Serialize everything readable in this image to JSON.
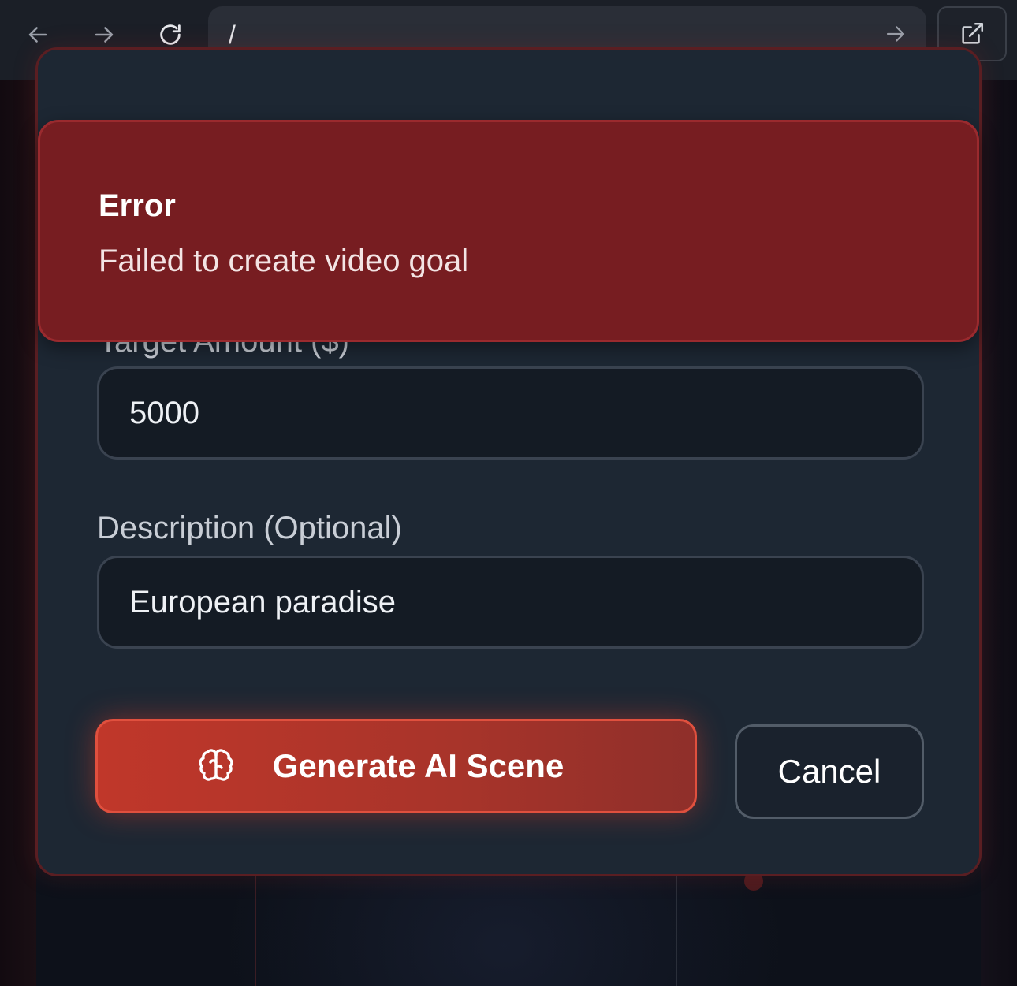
{
  "browser": {
    "url": "/",
    "back_icon": "arrow-left-icon",
    "forward_icon": "arrow-right-icon",
    "reload_icon": "reload-icon",
    "go_icon": "arrow-right-icon",
    "open_external_icon": "external-link-icon"
  },
  "form": {
    "target_amount_label": "Target Amount ($)",
    "target_amount_value": "5000",
    "description_label": "Description (Optional)",
    "description_value": "European paradise",
    "generate_label": "Generate AI Scene",
    "generate_icon": "brain-icon",
    "cancel_label": "Cancel"
  },
  "toast": {
    "title": "Error",
    "message": "Failed to create video goal"
  },
  "colors": {
    "accent": "#c0372a",
    "toast_bg": "#771d21",
    "modal_bg": "#1d2733"
  }
}
